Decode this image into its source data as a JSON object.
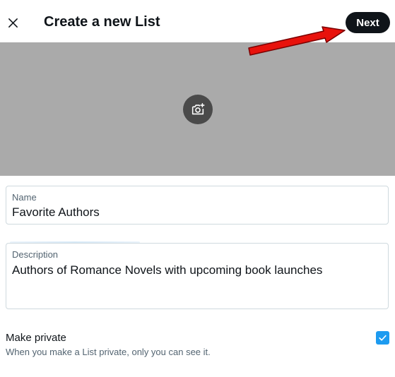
{
  "header": {
    "title": "Create a new List",
    "next_label": "Next",
    "close_icon": "close-icon"
  },
  "banner": {
    "camera_icon": "add-photo-icon"
  },
  "fields": {
    "name": {
      "label": "Name",
      "value": "Favorite Authors"
    },
    "description": {
      "label": "Description",
      "value": "Authors of Romance Novels with upcoming book launches"
    }
  },
  "privacy": {
    "label": "Make private",
    "help": "When you make a List private, only you can see it.",
    "checked": true
  },
  "colors": {
    "accent": "#1d9bf0",
    "button_bg": "#0f1419",
    "banner_bg": "#aaaaaa",
    "annotation_arrow": "#ff0000"
  }
}
